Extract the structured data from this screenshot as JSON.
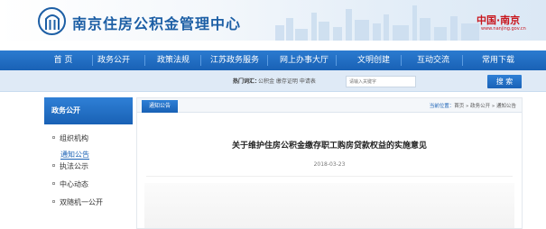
{
  "header": {
    "site_title": "南京住房公积金管理中心",
    "right_logo_text": "中国·南京",
    "right_logo_sub": "www.nanjing.gov.cn",
    "brand_color": "#1d5fa5",
    "accent_red": "#c8161d"
  },
  "nav": {
    "items": [
      {
        "label": "首  页"
      },
      {
        "label": "政务公开"
      },
      {
        "label": "政策法规"
      },
      {
        "label": "江苏政务服务"
      },
      {
        "label": "网上办事大厅"
      },
      {
        "label": "文明创建"
      },
      {
        "label": "互动交流"
      },
      {
        "label": "常用下载"
      }
    ]
  },
  "search": {
    "hot_label": "热门词汇：",
    "hot_words": "公积金  缴存证明  申请表",
    "placeholder": "请输入关键字",
    "button_label": "搜 索"
  },
  "sidebar": {
    "heading": "政务公开",
    "items": [
      {
        "label": "组织机构"
      },
      {
        "label": "通知公告"
      },
      {
        "label": "执法公示"
      },
      {
        "label": "中心动态"
      },
      {
        "label": "双随机一公开"
      }
    ]
  },
  "main": {
    "tab_label": "通知公告",
    "breadcrumb_label": "当前位置：",
    "breadcrumb_home": "首页",
    "breadcrumb_sep": " » ",
    "breadcrumb_section": "政务公开",
    "breadcrumb_current": "通知公告",
    "article_title": "关于维护住房公积金缴存职工购房贷款权益的实施意见",
    "article_date": "2018-03-23"
  }
}
